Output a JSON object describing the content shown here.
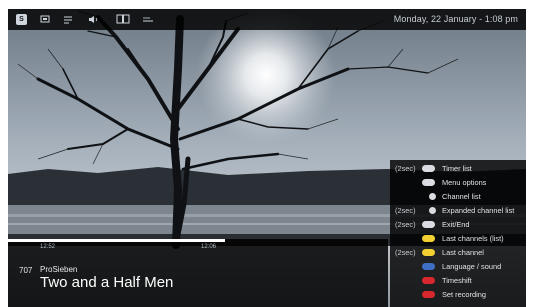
{
  "topbar": {
    "icons": [
      "app-logo-icon",
      "screen-icon",
      "list-icon",
      "speaker-icon",
      "book-icon",
      "menu-icon"
    ],
    "datetime": "Monday, 22 January - 1:08 pm"
  },
  "program": {
    "start_time": "12:52",
    "end_time": "12:06",
    "progress": 0.57,
    "channel_number": "707",
    "channel_name": "ProSieben",
    "title": "Two and a Half Men"
  },
  "legend": {
    "items": [
      {
        "prefix": "(2sec)",
        "key_color": "#d9dde1",
        "key_shape": "pill",
        "label": "Timer list"
      },
      {
        "prefix": "",
        "key_color": "#d9dde1",
        "key_shape": "pill",
        "label": "Menu options"
      },
      {
        "prefix": "",
        "key_color": "#d9dde1",
        "key_shape": "dot",
        "label": "Channel list"
      },
      {
        "prefix": "(2sec)",
        "key_color": "#d9dde1",
        "key_shape": "dot",
        "label": "Expanded channel list"
      },
      {
        "prefix": "(2sec)",
        "key_color": "#d9dde1",
        "key_shape": "pill",
        "label": "Exit/End"
      },
      {
        "prefix": "",
        "key_color": "#f2d033",
        "key_shape": "pill",
        "label": "Last channels (list)"
      },
      {
        "prefix": "(2sec)",
        "key_color": "#f2d033",
        "key_shape": "pill",
        "label": "Last channel"
      },
      {
        "prefix": "",
        "key_color": "#3e6fc4",
        "key_shape": "pill",
        "label": "Language / sound"
      },
      {
        "prefix": "",
        "key_color": "#d8282e",
        "key_shape": "pill",
        "label": "Timeshift"
      },
      {
        "prefix": "",
        "key_color": "#d8282e",
        "key_shape": "pill",
        "label": "Set recording"
      }
    ]
  }
}
